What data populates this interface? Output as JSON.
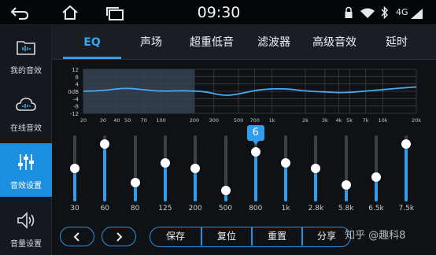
{
  "status_bar": {
    "time": "09:30",
    "network": "4G",
    "icons": [
      "back-icon",
      "home-icon",
      "recent-apps-icon",
      "lock-icon",
      "wifi-icon",
      "bluetooth-icon",
      "signal-icon"
    ]
  },
  "sidebar": {
    "items": [
      {
        "label": "我的音效",
        "icon": "music-folder-icon",
        "active": false
      },
      {
        "label": "在线音效",
        "icon": "cloud-music-icon",
        "active": false
      },
      {
        "label": "音效设置",
        "icon": "equalizer-icon",
        "active": true
      },
      {
        "label": "音量设置",
        "icon": "speaker-icon",
        "active": false
      }
    ]
  },
  "tabs": [
    {
      "label": "EQ",
      "active": true
    },
    {
      "label": "声场",
      "active": false
    },
    {
      "label": "超重低音",
      "active": false
    },
    {
      "label": "滤波器",
      "active": false
    },
    {
      "label": "高级音效",
      "active": false
    },
    {
      "label": "延时",
      "active": false
    }
  ],
  "graph": {
    "y_labels": [
      "12",
      "8",
      "4",
      "0dB",
      "-4",
      "-8",
      "-12"
    ],
    "x_labels": [
      "20",
      "30",
      "40",
      "50",
      "70",
      "100",
      "200",
      "300",
      "500",
      "700",
      "1k",
      "2k",
      "3k",
      "4k",
      "5k",
      "7k",
      "10k",
      "20k"
    ],
    "highlight_range": [
      "20",
      "200"
    ],
    "curve_color": "#4aa8f2"
  },
  "eq": {
    "bands": [
      {
        "freq": "30",
        "gain": 0
      },
      {
        "freq": "60",
        "gain": 9
      },
      {
        "freq": "80",
        "gain": -5
      },
      {
        "freq": "125",
        "gain": 2
      },
      {
        "freq": "200",
        "gain": 0
      },
      {
        "freq": "500",
        "gain": -8
      },
      {
        "freq": "800",
        "gain": 6
      },
      {
        "freq": "1k",
        "gain": 2
      },
      {
        "freq": "2.8k",
        "gain": 0
      },
      {
        "freq": "5.8k",
        "gain": -6
      },
      {
        "freq": "6.5k",
        "gain": -3
      },
      {
        "freq": "7.5k",
        "gain": 9
      }
    ],
    "selected_band": 6,
    "selected_value": "6",
    "range": [
      -12,
      12
    ]
  },
  "bottom": {
    "prev_icon": "chevron-left-icon",
    "next_icon": "chevron-right-icon",
    "actions": [
      "保存",
      "复位",
      "重置",
      "分享"
    ],
    "watermark": "知乎 @趣科8"
  },
  "colors": {
    "accent": "#2f9ef0",
    "background": "#0f1114",
    "sidebar_active": "#1c8fe0"
  }
}
